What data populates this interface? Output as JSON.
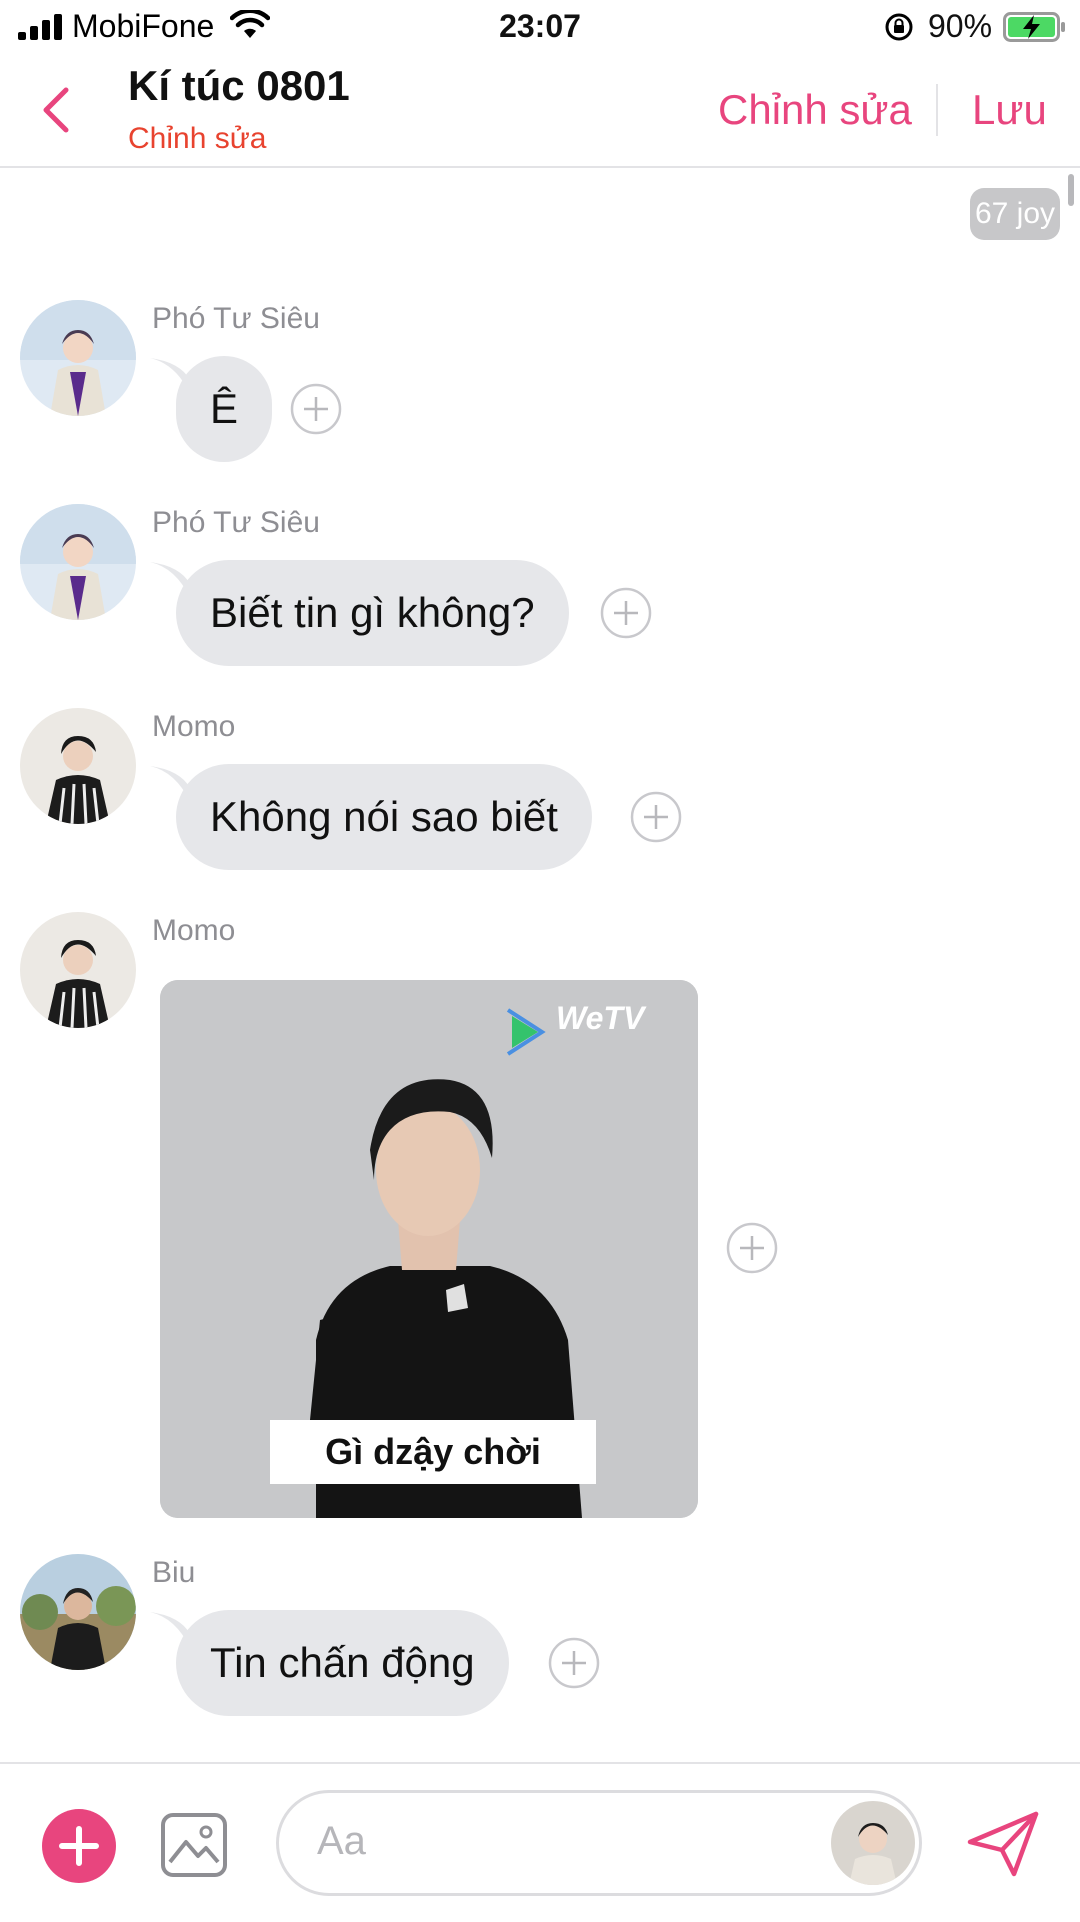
{
  "status_bar": {
    "carrier": "MobiFone",
    "time": "23:07",
    "battery": "90%"
  },
  "header": {
    "title": "Kí túc 0801",
    "subtitle": "Chỉnh sửa",
    "edit_label": "Chỉnh sửa",
    "save_label": "Lưu"
  },
  "badge": "67 joy",
  "messages": [
    {
      "sender": "Phó Tư Siêu",
      "text": "Ê"
    },
    {
      "sender": "Phó Tư Siêu",
      "text": "Biết tin gì không?"
    },
    {
      "sender": "Momo",
      "text": "Không nói sao biết"
    },
    {
      "sender": "Momo",
      "image_caption": "Gì dzậy chời",
      "image_watermark": "WeTV"
    },
    {
      "sender": "Biu",
      "text": "Tin chấn động"
    }
  ],
  "composer": {
    "placeholder": "Aa"
  },
  "colors": {
    "accent": "#e8457e",
    "subtitle": "#e8432f",
    "bubble": "#e6e7ea",
    "battery": "#4cd964"
  },
  "icons": [
    "back-chevron-icon",
    "plus-circle-icon",
    "gallery-icon",
    "send-icon",
    "wifi-icon",
    "signal-icon",
    "rotation-lock-icon",
    "battery-charging-icon"
  ]
}
